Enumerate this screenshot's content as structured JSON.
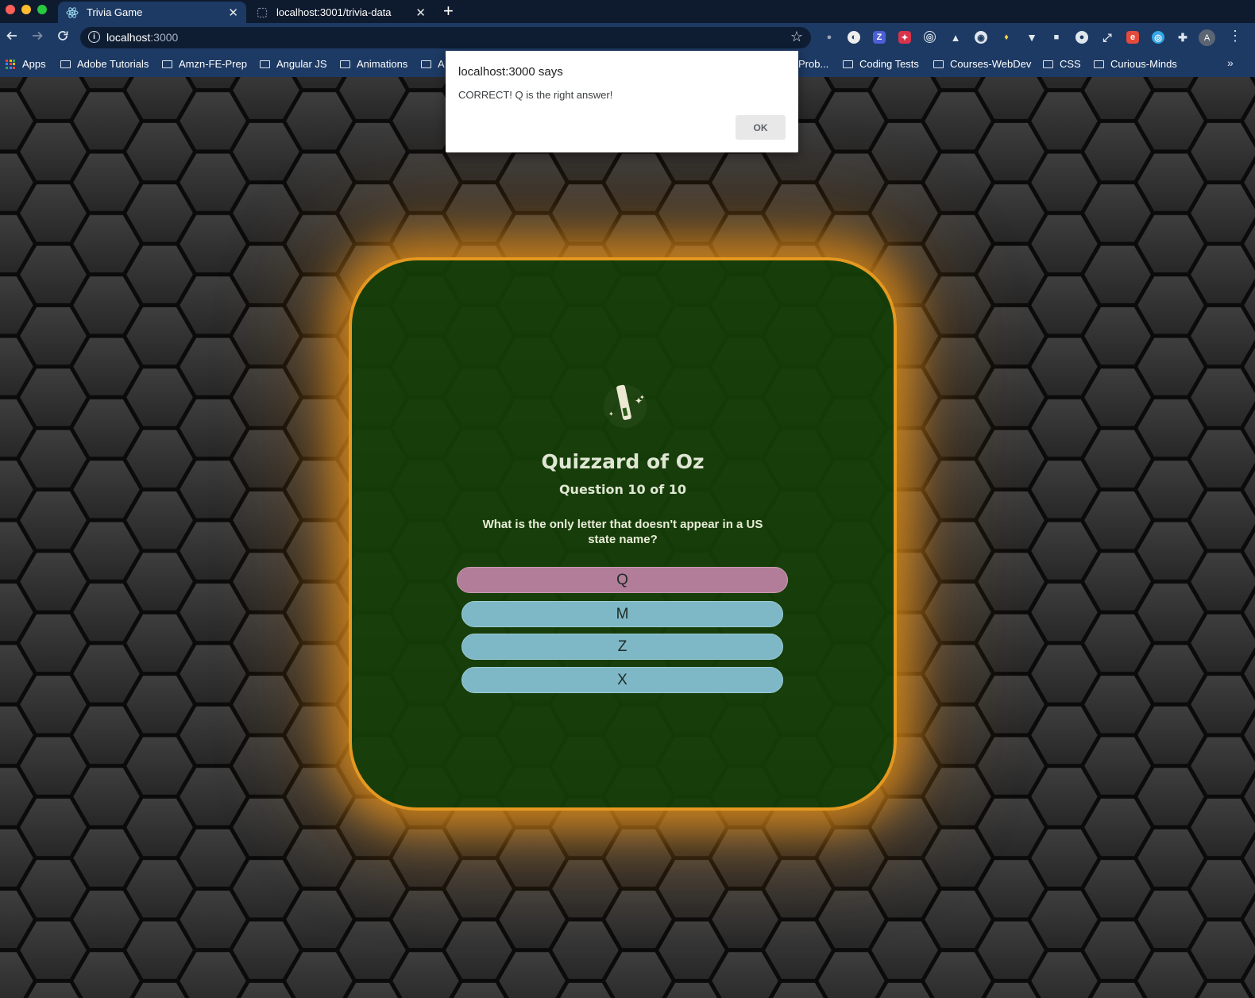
{
  "browser": {
    "tabs": [
      {
        "title": "Trivia Game",
        "active": true
      },
      {
        "title": "localhost:3001/trivia-data",
        "active": false
      }
    ],
    "new_tab_glyph": "+",
    "close_glyph": "✕",
    "address": {
      "host": "localhost",
      "port": ":3000"
    },
    "bookmarks": [
      "Apps",
      "Adobe Tutorials",
      "Amzn-FE-Prep",
      "Angular JS",
      "Animations",
      "A",
      "Prob...",
      "Coding Tests",
      "Courses-WebDev",
      "CSS",
      "Curious-Minds"
    ],
    "profile_initial": "A",
    "extensions": [
      "Z"
    ],
    "overflow_glyph": "»"
  },
  "dialog": {
    "origin": "localhost:3000 says",
    "message": "CORRECT! Q is the right answer!",
    "ok_label": "OK"
  },
  "game": {
    "title": "Quizzard of Oz",
    "progress": "Question 10 of 10",
    "question": "What is the only letter that doesn't appear in a US state name?",
    "answers": [
      {
        "label": "Q",
        "state": "correct"
      },
      {
        "label": "M",
        "state": "default"
      },
      {
        "label": "Z",
        "state": "default"
      },
      {
        "label": "X",
        "state": "default"
      }
    ]
  },
  "colors": {
    "chrome_dark": "#0e1a2e",
    "chrome": "#1d3a64",
    "card_fill": "#164008",
    "card_border": "#e5981f",
    "correct_answer": "#b27d98",
    "answer": "#7eb8c7"
  }
}
